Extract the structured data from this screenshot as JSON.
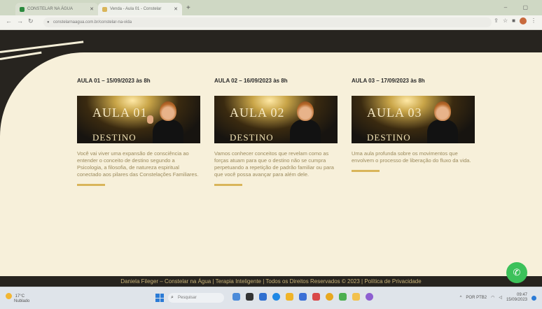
{
  "browser": {
    "tabs": [
      {
        "title": "CONSTELAR NA ÁGUA",
        "active": false
      },
      {
        "title": "Venda - Aula 01 - Constelar",
        "active": true
      }
    ],
    "url": "constelarnaagua.com.br/constelar-na-vida"
  },
  "lessons": [
    {
      "heading": "AULA 01 – 15/09/2023 às 8h",
      "thumb_title": "AULA 01",
      "thumb_brand": "DESTINO",
      "text": "Você vai viver uma expansão de consciência ao entender o conceito de destino segundo a Psicologia, a filosofia, de natureza espiritual conectado aos pilares das Constelações Familiares."
    },
    {
      "heading": "AULA 02 – 16/09/2023 às 8h",
      "thumb_title": "AULA 02",
      "thumb_brand": "DESTINO",
      "text": "Vamos conhecer conceitos que revelam como as forças atuam para que o destino não se cumpra perpetuando a repetição de padrão familiar ou para que você possa avançar para além dele."
    },
    {
      "heading": "AULA 03 – 17/09/2023 às 8h",
      "thumb_title": "AULA 03",
      "thumb_brand": "DESTINO",
      "text": "Uma aula profunda sobre os movimentos que envolvem o processo de liberação do fluxo da vida."
    }
  ],
  "footer": {
    "text": "Daniela Fileger – Constelar na Água | Terapia Inteligente | Todos os Direitos Reservados © 2023 | Política de Privacidade"
  },
  "taskbar": {
    "weather_temp": "17°C",
    "weather_desc": "Nublado",
    "search_placeholder": "Pesquisar",
    "lang": "POR PTB2",
    "time": "09:47",
    "date": "15/09/2023"
  },
  "colors": {
    "dark": "#27241f",
    "cream": "#f7f0da",
    "gold": "#c9b277",
    "whatsapp": "#3cc15a"
  }
}
